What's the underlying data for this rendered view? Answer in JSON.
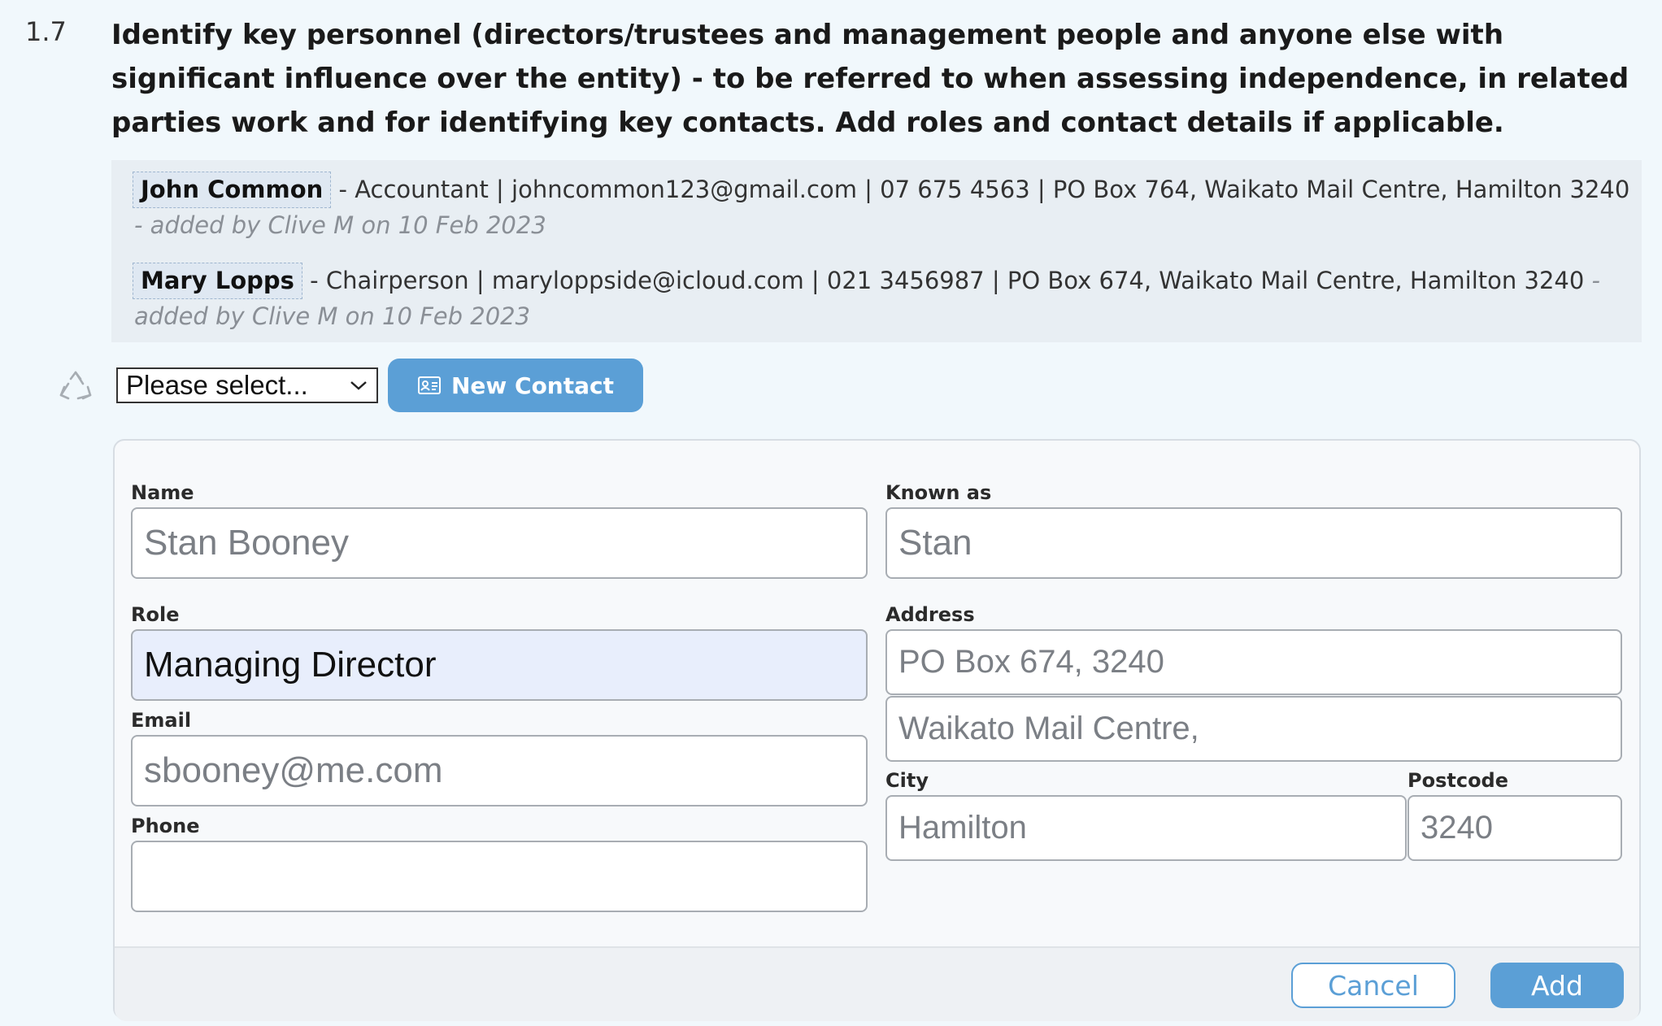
{
  "question": {
    "number": "1.7",
    "text": "Identify key personnel (directors/trustees and management people and anyone else with significant influence over the entity) - to be referred to when assessing independence, in related parties work and for identifying key contacts. Add roles and contact details if applicable."
  },
  "entries": [
    {
      "name": "John Common",
      "details": " - Accountant | johncommon123@gmail.com | 07 675 4563 | PO Box 764, Waikato Mail Centre, Hamilton 3240 ",
      "meta": "- added by Clive M on 10 Feb 2023"
    },
    {
      "name": "Mary Lopps",
      "details": " - Chairperson | maryloppside@icloud.com | 021 3456987 | PO Box 674, Waikato Mail Centre, Hamilton 3240 ",
      "meta": "- added by Clive M on 10 Feb 2023"
    }
  ],
  "toolbar": {
    "select_value": "Please select...",
    "new_contact_label": "New Contact"
  },
  "form": {
    "name_label": "Name",
    "name_value": "Stan Booney",
    "known_as_label": "Known as",
    "known_as_value": "Stan",
    "role_label": "Role",
    "role_value": "Managing Director",
    "address_label": "Address",
    "address_line1": "PO Box 674,   3240",
    "address_line2": "Waikato Mail Centre,",
    "email_label": "Email",
    "email_value": "sbooney@me.com",
    "city_label": "City",
    "city_value": "Hamilton",
    "postcode_label": "Postcode",
    "postcode_value": "3240",
    "phone_label": "Phone",
    "phone_value": "",
    "cancel_label": "Cancel",
    "add_label": "Add"
  },
  "colors": {
    "accent": "#5b9fd6",
    "background": "#f1f8fc",
    "entries_bg": "#e8eef3",
    "role_filled_bg": "#e8eefc"
  },
  "icons": [
    "recycle-icon",
    "chevron-down-icon",
    "contact-card-icon"
  ]
}
